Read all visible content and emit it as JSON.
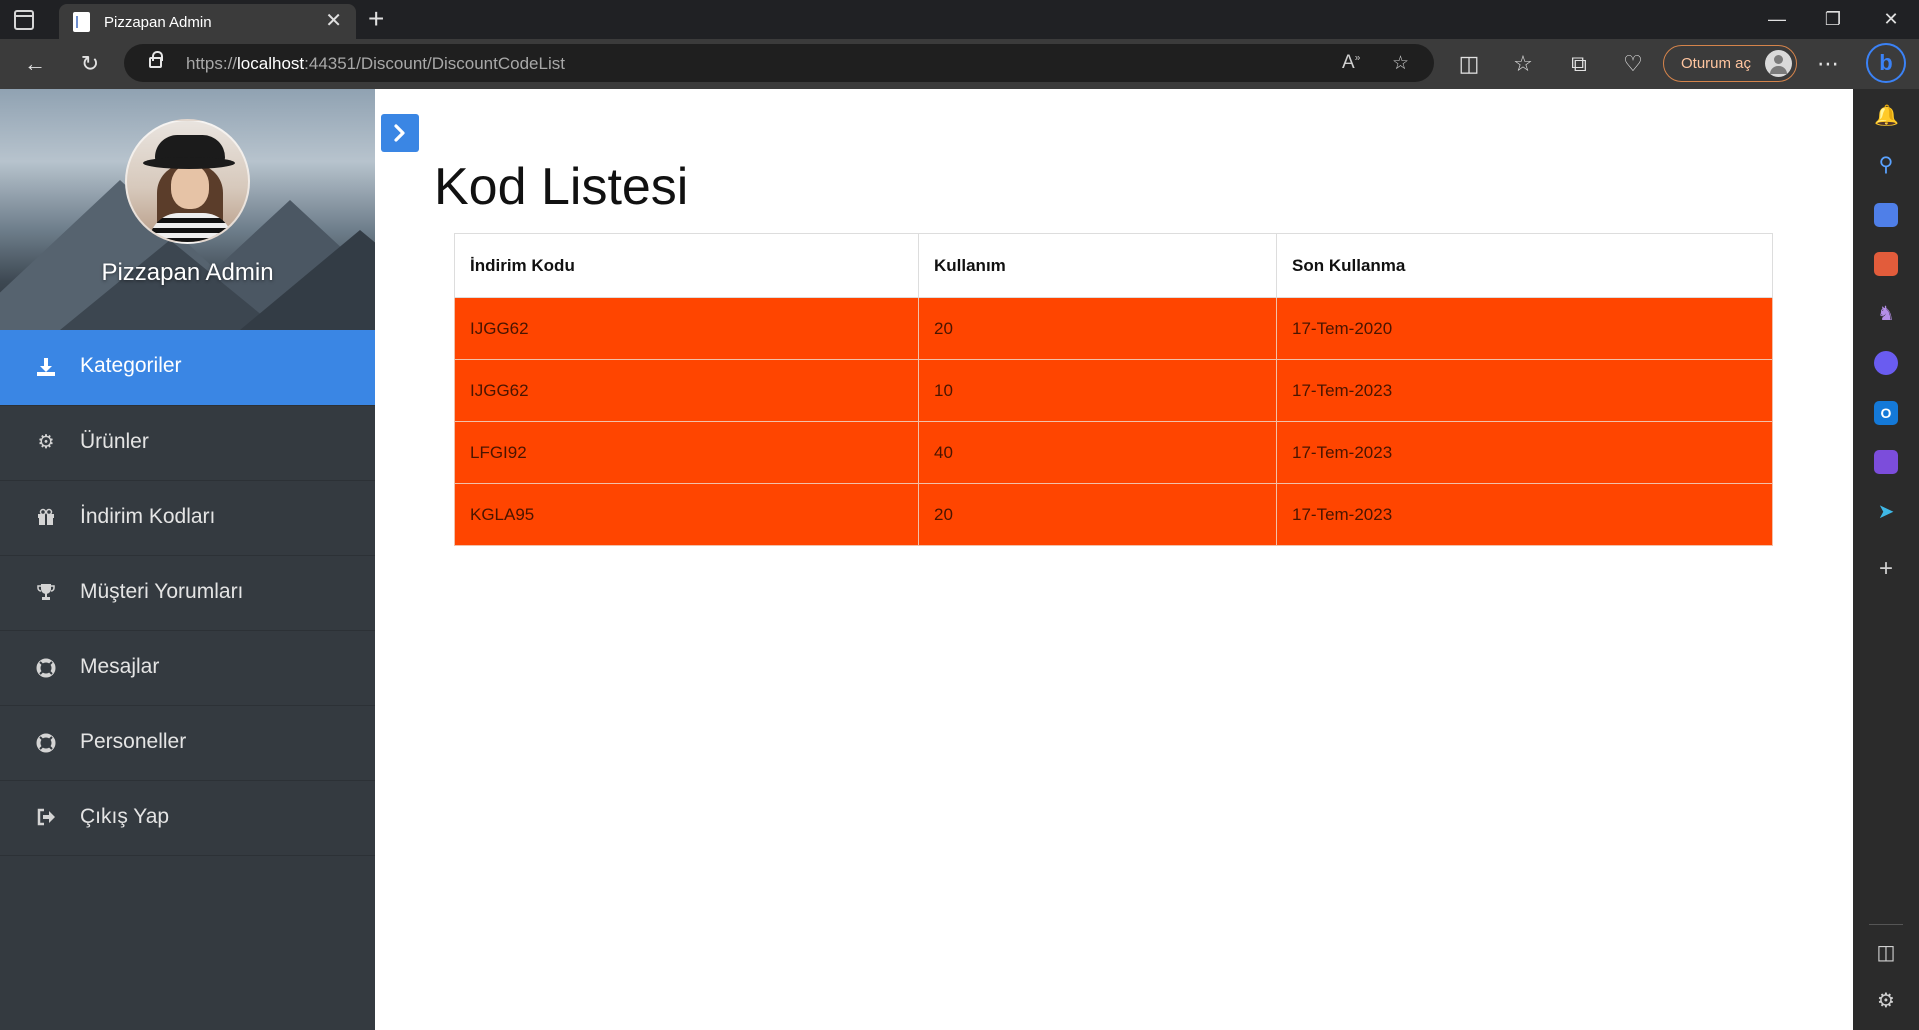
{
  "browser": {
    "tab_title": "Pizzapan Admin",
    "url_scheme": "https://",
    "url_host": "localhost",
    "url_rest": ":44351/Discount/DiscountCodeList",
    "signin_label": "Oturum aç"
  },
  "sidebar": {
    "title": "Pizzapan Admin",
    "items": [
      {
        "label": "Kategoriler",
        "icon": "download-icon",
        "active": true
      },
      {
        "label": "Ürünler",
        "icon": "gear-icon"
      },
      {
        "label": "İndirim Kodları",
        "icon": "gift-icon"
      },
      {
        "label": "Müşteri Yorumları",
        "icon": "trophy-icon"
      },
      {
        "label": "Mesajlar",
        "icon": "lifebuoy-icon"
      },
      {
        "label": "Personeller",
        "icon": "lifebuoy-icon"
      },
      {
        "label": "Çıkış Yap",
        "icon": "sign-out-icon"
      }
    ]
  },
  "main": {
    "heading": "Kod Listesi",
    "table": {
      "headers": [
        "İndirim Kodu",
        "Kullanım",
        "Son Kullanma"
      ],
      "rows": [
        [
          "IJGG62",
          "20",
          "17-Tem-2020"
        ],
        [
          "IJGG62",
          "10",
          "17-Tem-2023"
        ],
        [
          "LFGI92",
          "40",
          "17-Tem-2023"
        ],
        [
          "KGLA95",
          "20",
          "17-Tem-2023"
        ]
      ]
    }
  },
  "colors": {
    "accent": "#3a86e4",
    "row_background": "#ff4500",
    "sidebar": "#343a40"
  }
}
